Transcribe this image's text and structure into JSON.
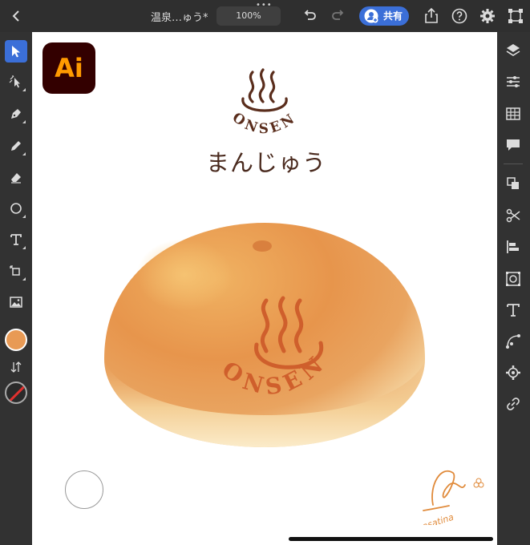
{
  "toolbar": {
    "document_title": "温泉…ゅう*",
    "zoom": "100%",
    "share_label": "共有",
    "icons": [
      "chevron-left-icon",
      "undo-icon",
      "redo-icon",
      "share-user-icon",
      "export-icon",
      "help-icon",
      "settings-icon",
      "crop-icon"
    ]
  },
  "left_tools": [
    "selection-arrow-icon",
    "direct-selection-icon",
    "pen-icon",
    "pencil-icon",
    "eraser-icon",
    "ellipse-icon",
    "type-icon",
    "transform-icon",
    "image-icon",
    "fill-swatch",
    "swap-icon",
    "stroke-none-swatch"
  ],
  "fill_color": "#e89a55",
  "right_tools": [
    "layers-icon",
    "properties-icon",
    "swatches-icon",
    "comments-icon",
    "pathfinder-icon",
    "scissors-icon",
    "align-icon",
    "symbol-icon",
    "type-panel-icon",
    "pathfinder-curve-icon",
    "settings-gear-icon",
    "link-icon"
  ],
  "canvas": {
    "app_logo": "Ai",
    "brand_word": "ONSEN",
    "brand_subtitle": "まんじゅう",
    "bun_stamp_word": "ONSEN",
    "signature": "asatina"
  },
  "colors": {
    "accent": "#3b6fd8",
    "brand_brown": "#5a2d1c",
    "stamp_red": "#c85a2a",
    "bun_orange": "#e5934a"
  }
}
